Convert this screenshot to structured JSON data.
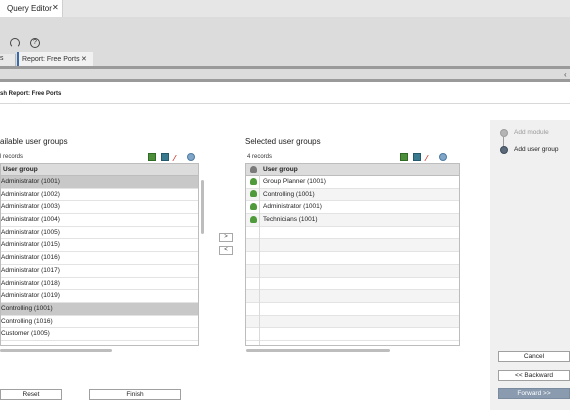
{
  "tabs": {
    "doc_tab": "Query Editor",
    "doc_close": "✕",
    "sub_prev": "s",
    "sub_tab": "Report: Free Ports",
    "sub_close": "✕"
  },
  "toolbar": {
    "refresh": "↻",
    "help": "?"
  },
  "corner": "‹",
  "wizard": {
    "title": "sh Report: Free Ports"
  },
  "available": {
    "title": "ailable user groups",
    "count": "l records",
    "header": "User group",
    "rows": [
      {
        "label": "Administrator (1001)",
        "selected": true
      },
      {
        "label": "Administrator (1002)",
        "selected": false
      },
      {
        "label": "Administrator (1003)",
        "selected": false
      },
      {
        "label": "Administrator (1004)",
        "selected": false
      },
      {
        "label": "Administrator (1005)",
        "selected": false
      },
      {
        "label": "Administrator (1015)",
        "selected": false
      },
      {
        "label": "Administrator (1016)",
        "selected": false
      },
      {
        "label": "Administrator (1017)",
        "selected": false
      },
      {
        "label": "Administrator (1018)",
        "selected": false
      },
      {
        "label": "Administrator (1019)",
        "selected": false
      },
      {
        "label": "Controlling (1001)",
        "selected": true
      },
      {
        "label": "Controlling (1016)",
        "selected": false
      },
      {
        "label": "Customer (1005)",
        "selected": false
      }
    ]
  },
  "move": {
    "right": ">",
    "left": "<"
  },
  "selected": {
    "title": "Selected user groups",
    "count": "4 records",
    "header": "User group",
    "rows": [
      "Group Planner (1001)",
      "Controlling (1001)",
      "Administrator (1001)",
      "Technicians (1001)"
    ]
  },
  "steps": [
    {
      "label": "Add module",
      "state": "done"
    },
    {
      "label": "Add user group",
      "state": "current"
    }
  ],
  "buttons": {
    "cancel": "Cancel",
    "backward": "<< Backward",
    "forward": "Forward >>",
    "reset": "Reset",
    "finish": "Finish"
  },
  "colors": {
    "accent": "#3a6aa8",
    "forward_bg": "#8a9bb0",
    "selection": "#c8c8c8"
  }
}
